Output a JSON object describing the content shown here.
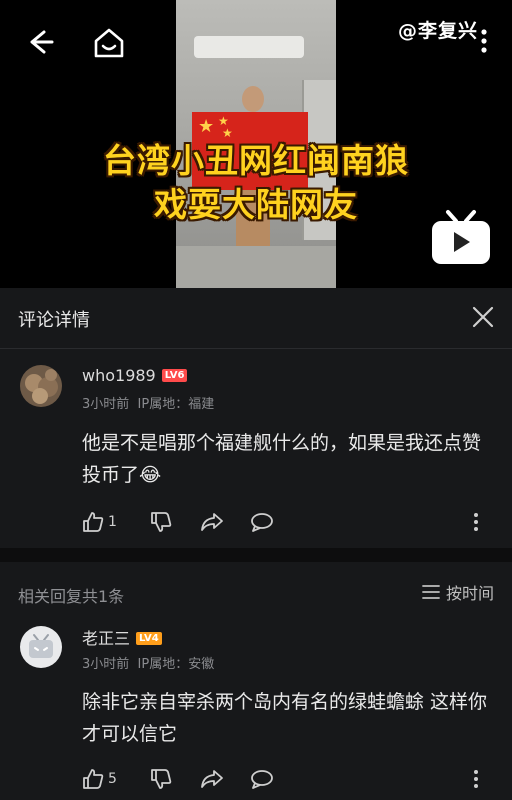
{
  "video": {
    "caption_line1": "台湾小丑网红闽南狼",
    "caption_line2": "戏耍大陆网友",
    "watermark": "@李复兴"
  },
  "panel": {
    "title": "评论详情"
  },
  "main_comment": {
    "username": "who1989",
    "level": "LV6",
    "time": "3小时前",
    "location": "IP属地：福建",
    "text": "他是不是唱那个福建舰什么的，如果是我还点赞投币了😂",
    "likes": "1"
  },
  "replies": {
    "label": "相关回复共1条",
    "sort_label": "按时间"
  },
  "reply_comment": {
    "username": "老正三",
    "level": "LV4",
    "time": "3小时前",
    "location": "IP属地：安徽",
    "text": "除非它亲自宰杀两个岛内有名的绿蛙蟾蜍 这样你才可以信它",
    "likes": "5"
  },
  "colors": {
    "background": "#17181a",
    "caption_yellow": "#ffd21f",
    "level6": "#ff4b4b",
    "level4": "#ff9e1b"
  }
}
